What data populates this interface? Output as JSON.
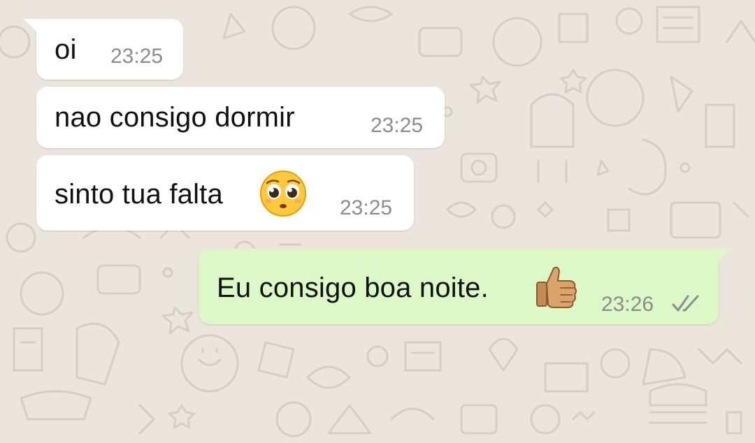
{
  "conversation": {
    "messages": [
      {
        "direction": "incoming",
        "text": "oi",
        "time": "23:25"
      },
      {
        "direction": "incoming",
        "text": "nao consigo dormir",
        "time": "23:25"
      },
      {
        "direction": "incoming",
        "text": "sinto tua falta",
        "emoji": "pleading-face-emoji",
        "time": "23:25"
      },
      {
        "direction": "outgoing",
        "text": "Eu consigo boa noite.",
        "emoji": "thumbs-up-emoji",
        "time": "23:26",
        "status": "read-double-check"
      }
    ]
  },
  "colors": {
    "background": "#ECE5DD",
    "incoming_bubble": "#FFFFFF",
    "outgoing_bubble": "#DCF8C6",
    "timestamp": "#8C8C8C",
    "wallpaper_doodle": "#D9D0C4"
  }
}
